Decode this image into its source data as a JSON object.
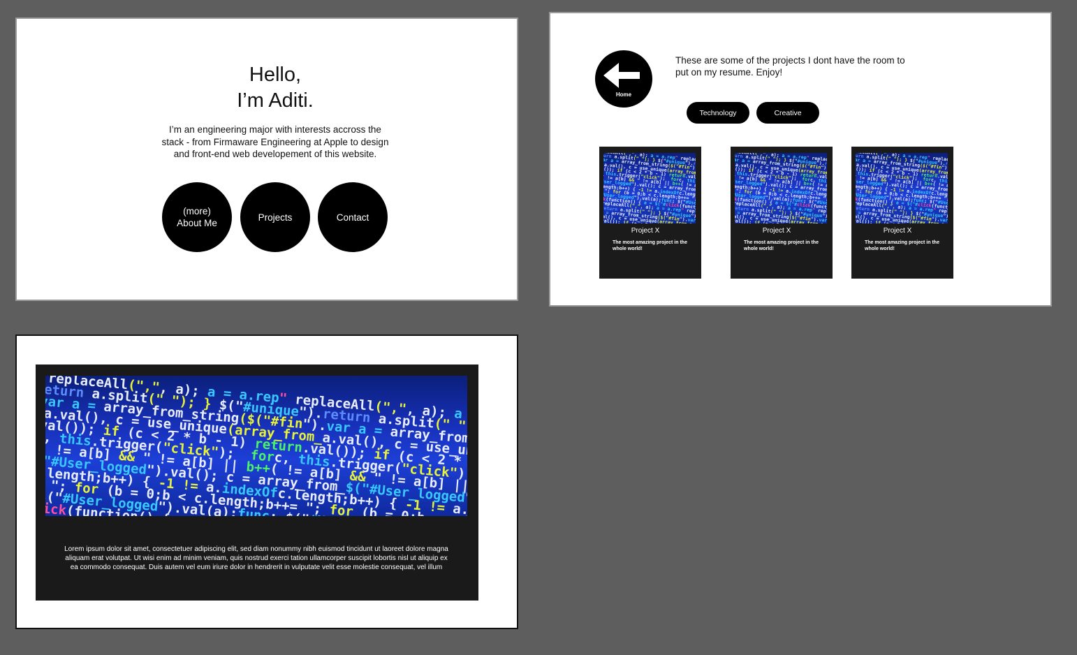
{
  "home": {
    "hello_line1": "Hello,",
    "hello_line2": "I’m  Aditi.",
    "intro": "I’m an engineering major with interests accross the stack - from Firmaware Engineering at Apple to design and front-end web developement of this website.",
    "about_line1": "(more)",
    "about_line2": "About Me",
    "projects_label": "Projects",
    "contact_label": "Contact"
  },
  "projects": {
    "home_label": "Home",
    "intro": "These are some of the projects I dont have the room to put on my resume. Enjoy!",
    "filters": [
      "Technology",
      "Creative"
    ],
    "cards": [
      {
        "title": "Project X",
        "desc": "The most amazing project in the whole world!"
      },
      {
        "title": "Project X",
        "desc": "The most amazing project in the whole world!"
      },
      {
        "title": "Project X",
        "desc": "The most amazing project in the whole world!"
      }
    ]
  },
  "detail": {
    "body": "Lorem ipsum dolor sit amet, consectetuer adipiscing elit, sed diam nonummy nibh euismod tincidunt ut laoreet dolore magna aliquam erat volutpat. Ut wisi enim ad minim veniam, quis nostrud exerci tation ullamcorper suscipit lobortis nisl ut aliquip ex ea commodo consequat. Duis autem vel eum iriure dolor in hendrerit in vulputate velit esse molestie consequat, vel illum"
  },
  "colors": {
    "canvas": "#5e5e5e",
    "artboard": "#ffffff",
    "button": "#000000",
    "card": "#1b1b1b"
  },
  "icons": {
    "back": "back-arrow-icon"
  }
}
